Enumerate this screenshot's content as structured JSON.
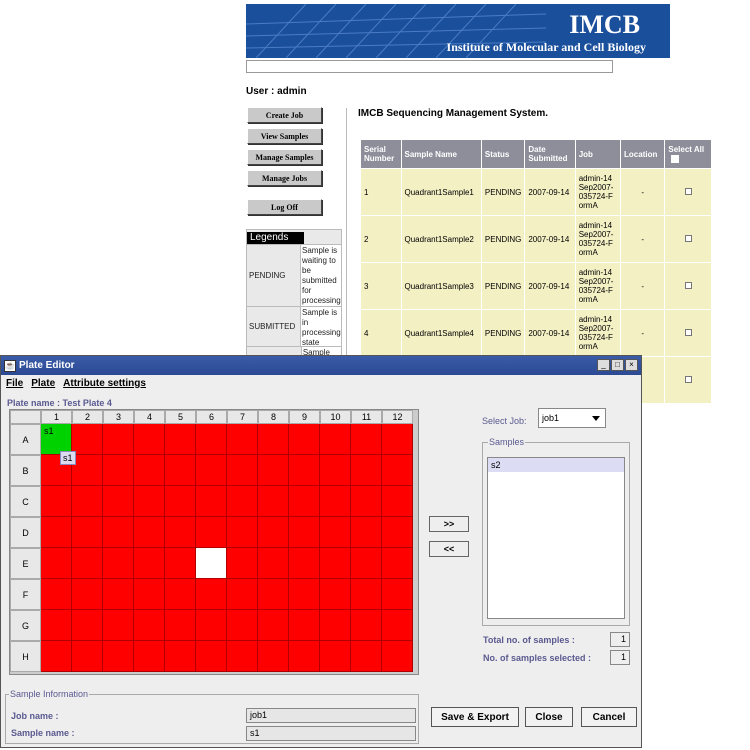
{
  "banner": {
    "title": "IMCB",
    "subtitle": "Institute of Molecular and Cell Biology",
    "color": "#1a4f9c"
  },
  "user_line": "User : admin",
  "nav_buttons": [
    "Create Job",
    "View Samples",
    "Manage Samples",
    "Manage Jobs",
    "Log Off"
  ],
  "legends": {
    "title": "Legends",
    "rows": [
      {
        "status": "PENDING",
        "description": "Sample is waiting to be submitted for processing"
      },
      {
        "status": "SUBMITTED",
        "description": "Sample is in processing state"
      },
      {
        "status": "",
        "description": "Sample"
      }
    ]
  },
  "system_title": "IMCB Sequencing Management System.",
  "jobs_table": {
    "headers": [
      "Serial Number",
      "Sample Name",
      "Status",
      "Date Submitted",
      "Job",
      "Location",
      "Select All"
    ],
    "rows": [
      {
        "serial": "1",
        "sample": "Quadrant1Sample1",
        "status": "PENDING",
        "date": "2007-09-14",
        "job": "admin-14Sep2007-035724-FormA",
        "location": "-"
      },
      {
        "serial": "2",
        "sample": "Quadrant1Sample2",
        "status": "PENDING",
        "date": "2007-09-14",
        "job": "admin-14Sep2007-035724-FormA",
        "location": "-"
      },
      {
        "serial": "3",
        "sample": "Quadrant1Sample3",
        "status": "PENDING",
        "date": "2007-09-14",
        "job": "admin-14Sep2007-035724-FormA",
        "location": "-"
      },
      {
        "serial": "4",
        "sample": "Quadrant1Sample4",
        "status": "PENDING",
        "date": "2007-09-14",
        "job": "admin-14Sep2007-035724-FormA",
        "location": "-"
      },
      {
        "serial": "",
        "sample": "",
        "status": "",
        "date": "",
        "job": "",
        "location": ""
      }
    ]
  },
  "plate_editor": {
    "window_title": "Plate Editor",
    "menu": [
      "File",
      "Plate",
      "Attribute settings"
    ],
    "plate_name": "Plate name : Test Plate 4",
    "columns": [
      "1",
      "2",
      "3",
      "4",
      "5",
      "6",
      "7",
      "8",
      "9",
      "10",
      "11",
      "12"
    ],
    "rows": [
      "A",
      "B",
      "C",
      "D",
      "E",
      "F",
      "G",
      "H"
    ],
    "occupied_well": {
      "row": "A",
      "col": "1",
      "label": "s1"
    },
    "empty_well": {
      "row": "E",
      "col": "6"
    },
    "tooltip": "s1",
    "select_job_label": "Select Job:",
    "select_job_value": "job1",
    "samples_title": "Samples",
    "samples": [
      "s2"
    ],
    "move_right": ">>",
    "move_left": "<<",
    "total_label": "Total no. of samples :",
    "total_value": "1",
    "selected_label": "No. of samples selected :",
    "selected_value": "1",
    "info_title": "Sample Information",
    "job_name_label": "Job name :",
    "job_name_value": "job1",
    "sample_name_label": "Sample name :",
    "sample_name_value": "s1",
    "buttons": {
      "save_export": "Save & Export",
      "close": "Close",
      "cancel": "Cancel"
    },
    "colors": {
      "occupied": "#00d200",
      "filled": "#ff0000",
      "empty": "#ffffff",
      "label": "#5a5a90"
    }
  }
}
